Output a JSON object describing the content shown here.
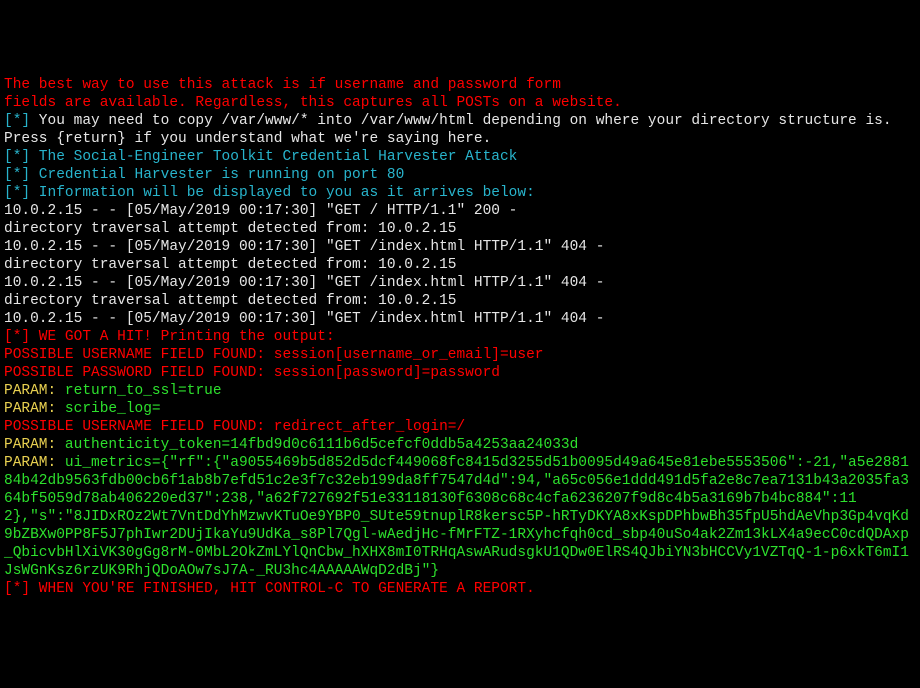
{
  "lines": {
    "intro1": "The best way to use this attack is if username and password form",
    "intro2": "fields are available. Regardless, this captures all POSTs on a website.",
    "star": "[*]",
    "copy_msg": " You may need to copy /var/www/* into /var/www/html depending on where your directory structure is.",
    "press_return": "Press {return} if you understand what we're saying here.",
    "set_cred": " The Social-Engineer Toolkit Credential Harvester Attack",
    "harvester_run": " Credential Harvester is running on port 80",
    "info_display": " Information will be displayed to you as it arrives below:",
    "log1": "10.0.2.15 - - [05/May/2019 00:17:30] \"GET / HTTP/1.1\" 200 -",
    "trav1": "directory traversal attempt detected from: 10.0.2.15",
    "log2": "10.0.2.15 - - [05/May/2019 00:17:30] \"GET /index.html HTTP/1.1\" 404 -",
    "trav2": "directory traversal attempt detected from: 10.0.2.15",
    "log3": "10.0.2.15 - - [05/May/2019 00:17:30] \"GET /index.html HTTP/1.1\" 404 -",
    "trav3": "directory traversal attempt detected from: 10.0.2.15",
    "log4": "10.0.2.15 - - [05/May/2019 00:17:30] \"GET /index.html HTTP/1.1\" 404 -",
    "hit_prefix": "[*] WE GOT A HIT! Printing the output:",
    "user_found": "POSSIBLE USERNAME FIELD FOUND: session[username_or_email]=user",
    "pass_found": "POSSIBLE PASSWORD FIELD FOUND: session[password]=password",
    "param_label": "PARAM: ",
    "param_return": "return_to_ssl=true",
    "param_scribe": "scribe_log=",
    "redirect_found": "POSSIBLE USERNAME FIELD FOUND: redirect_after_login=/",
    "param_auth": "authenticity_token=14fbd9d0c6111b6d5cefcf0ddb5a4253aa24033d",
    "param_ui": "ui_metrics={\"rf\":{\"a9055469b5d852d5dcf449068fc8415d3255d51b0095d49a645e81ebe5553506\":-21,\"a5e288184b42db9563fdb00cb6f1ab8b7efd51c2e3f7c32eb199da8ff7547d4d\":94,\"a65c056e1ddd491d5fa2e8c7ea7131b43a2035fa364bf5059d78ab406220ed37\":238,\"a62f727692f51e33118130f6308c68c4cfa6236207f9d8c4b5a3169b7b4bc884\":112},\"s\":\"8JIDxROz2Wt7VntDdYhMzwvKTuOe9YBP0_SUte59tnuplR8kersc5P-hRTyDKYA8xKspDPhbwBh35fpU5hdAeVhp3Gp4vqKd9bZBXw0PP8F5J7phIwr2DUjIkaYu9UdKa_s8Pl7Qgl-wAedjHc-fMrFTZ-1RXyhcfqh0cd_sbp40uSo4ak2Zm13kLX4a9ecC0cdQDAxp_QbicvbHlXiVK30gGg8rM-0MbL2OkZmLYlQnCbw_hXHX8mI0TRHqAswARudsgkU1QDw0ElRS4QJbiYN3bHCCVy1VZTqQ-1-p6xkT6mI1JsWGnKsz6rzUK9RhjQDoAOw7sJ7A-_RU3hc4AAAAAWqD2dBj\"}",
    "finish_prefix": "[*]",
    "finish_msg": " WHEN YOU'RE FINISHED, HIT CONTROL-C TO GENERATE A REPORT."
  }
}
